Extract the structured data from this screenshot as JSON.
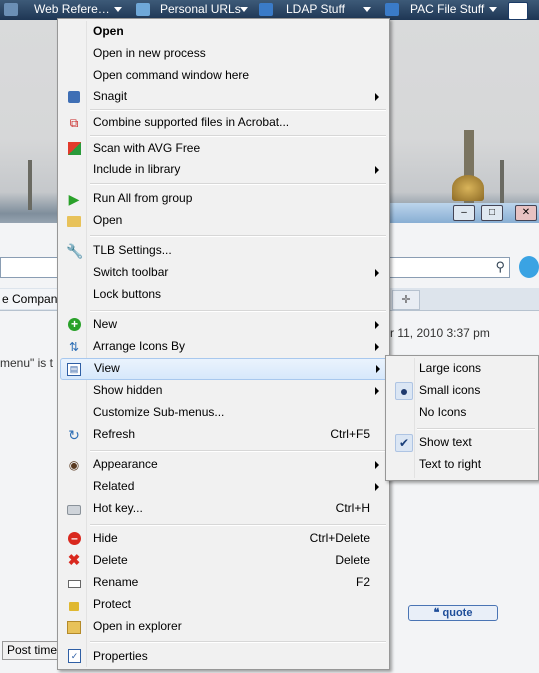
{
  "taskbar": {
    "items": [
      {
        "label": "Web Refere…",
        "icon": "globe-icon"
      },
      {
        "label": "Personal URLs",
        "icon": "network-globe-icon"
      },
      {
        "label": "LDAP Stuff",
        "icon": "monitor-icon"
      },
      {
        "label": "PAC File Stuff",
        "icon": "monitor-icon"
      }
    ]
  },
  "background_window": {
    "tab_label": "e Compani",
    "date_text": "r 11, 2010 3:37 pm",
    "body_text": "menu\" is t",
    "quote_label": "quote",
    "post_time_label": "Post time"
  },
  "context_menu": {
    "items": [
      {
        "label": "Open",
        "bold": true
      },
      {
        "label": "Open in new process"
      },
      {
        "label": "Open command window here"
      },
      {
        "label": "Snagit",
        "icon": "snagit-icon",
        "submenu": true
      },
      {
        "label": "Combine supported files in Acrobat...",
        "icon": "acrobat-icon"
      },
      {
        "label": "Scan with AVG Free",
        "icon": "avg-icon"
      },
      {
        "label": "Include in library",
        "submenu": true
      },
      {
        "label": "Run All from group",
        "icon": "play-icon"
      },
      {
        "label": "Open",
        "icon": "folder-icon"
      },
      {
        "label": "TLB Settings...",
        "icon": "wrench-icon"
      },
      {
        "label": "Switch toolbar",
        "submenu": true
      },
      {
        "label": "Lock buttons"
      },
      {
        "label": "New",
        "icon": "add-icon",
        "submenu": true
      },
      {
        "label": "Arrange Icons By",
        "icon": "arrange-icon",
        "submenu": true
      },
      {
        "label": "View",
        "icon": "view-icon",
        "submenu": true,
        "highlighted": true
      },
      {
        "label": "Show hidden",
        "submenu": true
      },
      {
        "label": "Customize Sub-menus..."
      },
      {
        "label": "Refresh",
        "icon": "refresh-icon",
        "shortcut": "Ctrl+F5"
      },
      {
        "label": "Appearance",
        "icon": "eye-icon",
        "submenu": true
      },
      {
        "label": "Related",
        "submenu": true
      },
      {
        "label": "Hot key...",
        "icon": "keyboard-icon",
        "shortcut": "Ctrl+H"
      },
      {
        "label": "Hide",
        "icon": "hide-icon",
        "shortcut": "Ctrl+Delete"
      },
      {
        "label": "Delete",
        "icon": "delete-icon",
        "shortcut": "Delete"
      },
      {
        "label": "Rename",
        "icon": "rename-icon",
        "shortcut": "F2"
      },
      {
        "label": "Protect",
        "icon": "lock-icon"
      },
      {
        "label": "Open in explorer",
        "icon": "explorer-icon"
      },
      {
        "label": "Properties",
        "icon": "properties-icon"
      }
    ]
  },
  "view_submenu": {
    "items": [
      {
        "label": "Large icons"
      },
      {
        "label": "Small icons",
        "selected": true
      },
      {
        "label": "No Icons"
      },
      {
        "label": "Show text",
        "checked": true
      },
      {
        "label": "Text to right"
      }
    ]
  },
  "colors": {
    "menu_bg": "#f1f1f1",
    "highlight": "#d7e8fb",
    "taskbar": "#1e3654"
  }
}
